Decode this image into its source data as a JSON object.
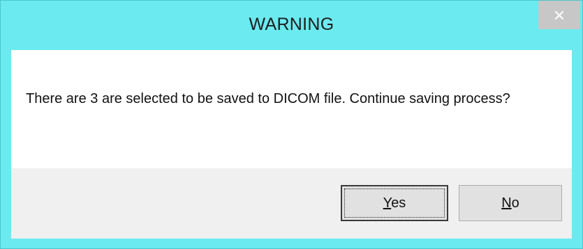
{
  "dialog": {
    "title": "WARNING",
    "message": "There are 3 are selected to be saved to DICOM file. Continue saving process?",
    "buttons": {
      "yes": {
        "mnemonic": "Y",
        "rest": "es"
      },
      "no": {
        "mnemonic": "N",
        "rest": "o"
      }
    }
  },
  "colors": {
    "title_bar": "#6beaf0",
    "close_button": "#c7c7c7",
    "button_area": "#f0f0f0"
  },
  "icons": {
    "close": "close-icon"
  }
}
